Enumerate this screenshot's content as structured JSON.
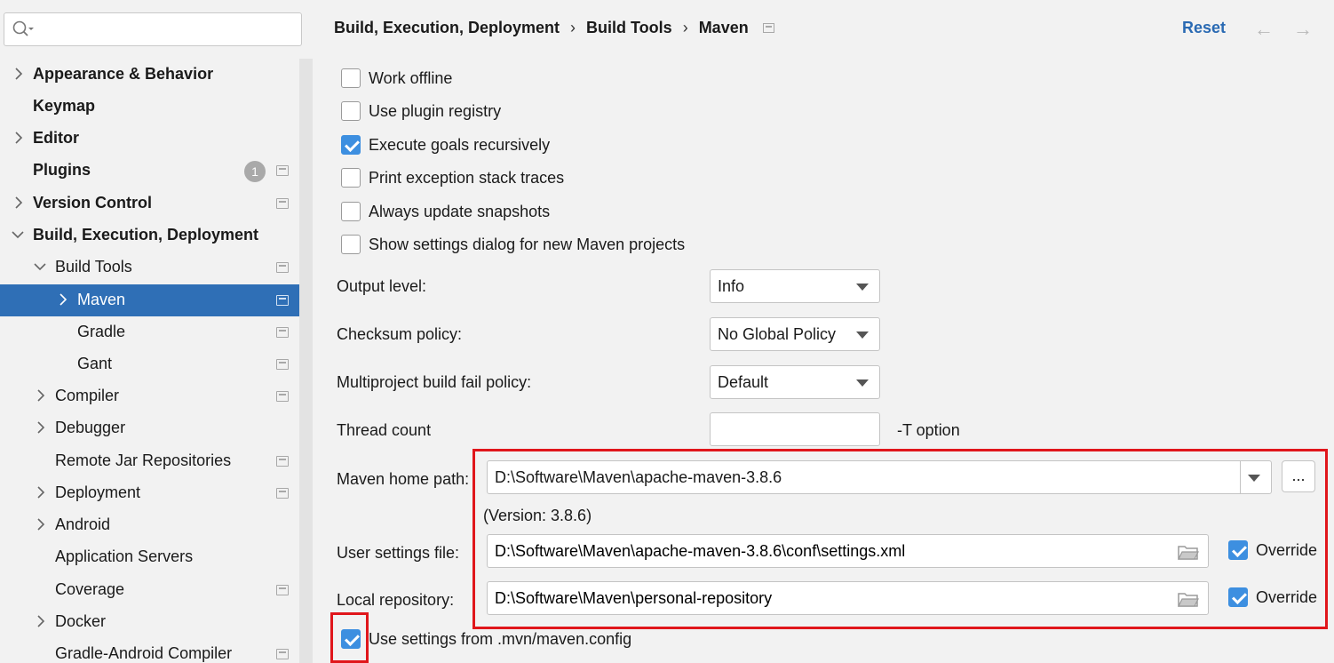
{
  "search": {
    "placeholder": ""
  },
  "sidebar": {
    "items": [
      {
        "label": "Appearance & Behavior"
      },
      {
        "label": "Keymap"
      },
      {
        "label": "Editor"
      },
      {
        "label": "Plugins",
        "badge": "1"
      },
      {
        "label": "Version Control"
      },
      {
        "label": "Build, Execution, Deployment"
      },
      {
        "label": "Build Tools"
      },
      {
        "label": "Maven"
      },
      {
        "label": "Gradle"
      },
      {
        "label": "Gant"
      },
      {
        "label": "Compiler"
      },
      {
        "label": "Debugger"
      },
      {
        "label": "Remote Jar Repositories"
      },
      {
        "label": "Deployment"
      },
      {
        "label": "Android"
      },
      {
        "label": "Application Servers"
      },
      {
        "label": "Coverage"
      },
      {
        "label": "Docker"
      },
      {
        "label": "Gradle-Android Compiler"
      }
    ]
  },
  "breadcrumb": {
    "items": [
      "Build, Execution, Deployment",
      "Build Tools",
      "Maven"
    ],
    "separator": "›"
  },
  "header": {
    "reset_label": "Reset",
    "back_arrow": "←",
    "forward_arrow": "→"
  },
  "options": [
    {
      "label": "Work offline",
      "checked": false
    },
    {
      "label": "Use plugin registry",
      "checked": false
    },
    {
      "label": "Execute goals recursively",
      "checked": true
    },
    {
      "label": "Print exception stack traces",
      "checked": false
    },
    {
      "label": "Always update snapshots",
      "checked": false
    },
    {
      "label": "Show settings dialog for new Maven projects",
      "checked": false
    }
  ],
  "form": {
    "output_level": {
      "label": "Output level:",
      "value": "Info"
    },
    "checksum_policy": {
      "label": "Checksum policy:",
      "value": "No Global Policy"
    },
    "multiproject_fail_policy": {
      "label": "Multiproject build fail policy:",
      "value": "Default"
    },
    "thread_count": {
      "label": "Thread count",
      "value": "",
      "suffix": "-T option"
    },
    "maven_home": {
      "label": "Maven home path:",
      "value": "D:\\Software\\Maven\\apache-maven-3.8.6",
      "version": "(Version: 3.8.6)",
      "browse_label": "..."
    },
    "user_settings": {
      "label": "User settings file:",
      "value": "D:\\Software\\Maven\\apache-maven-3.8.6\\conf\\settings.xml",
      "override_label": "Override",
      "override_checked": true
    },
    "local_repo": {
      "label": "Local repository:",
      "value": "D:\\Software\\Maven\\personal-repository",
      "override_label": "Override",
      "override_checked": true
    },
    "mvn_config": {
      "label": "Use settings from .mvn/maven.config",
      "checked": true
    }
  },
  "colors": {
    "selection": "#2f6fb6",
    "link": "#2a6ab3",
    "checkbox": "#3d8fe0",
    "highlight": "#e0161b"
  }
}
